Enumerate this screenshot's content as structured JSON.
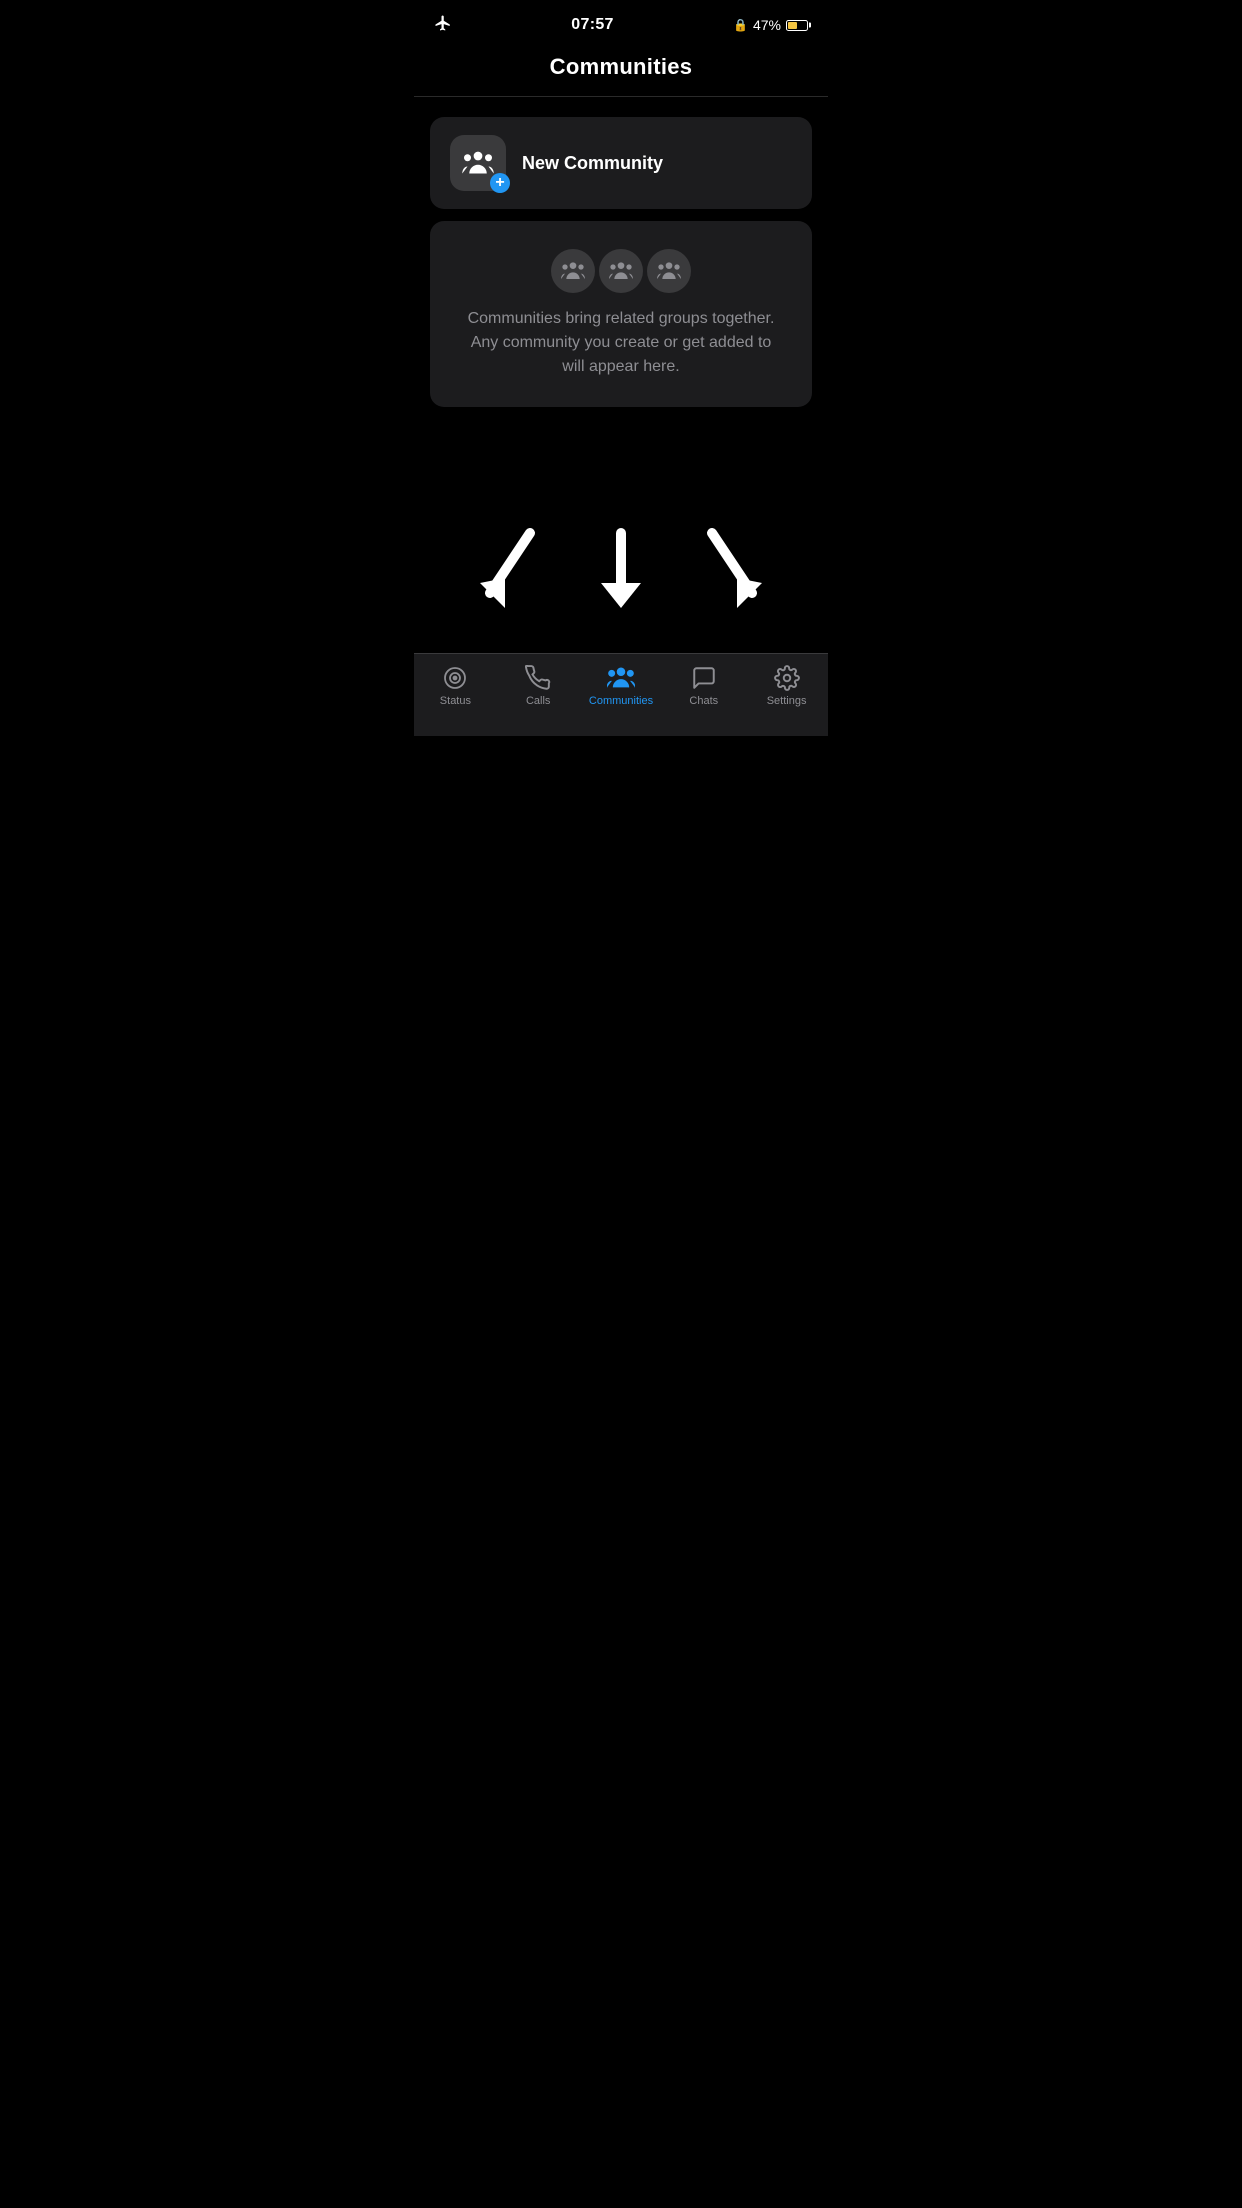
{
  "statusBar": {
    "time": "07:57",
    "batteryPercent": "47%",
    "batteryLevel": 47
  },
  "pageTitle": "Communities",
  "newCommunity": {
    "label": "New Community"
  },
  "infoCard": {
    "text": "Communities bring related groups together. Any community you create or get added to will appear here."
  },
  "tabs": [
    {
      "id": "status",
      "label": "Status",
      "active": false
    },
    {
      "id": "calls",
      "label": "Calls",
      "active": false
    },
    {
      "id": "communities",
      "label": "Communities",
      "active": true
    },
    {
      "id": "chats",
      "label": "Chats",
      "active": false
    },
    {
      "id": "settings",
      "label": "Settings",
      "active": false
    }
  ]
}
